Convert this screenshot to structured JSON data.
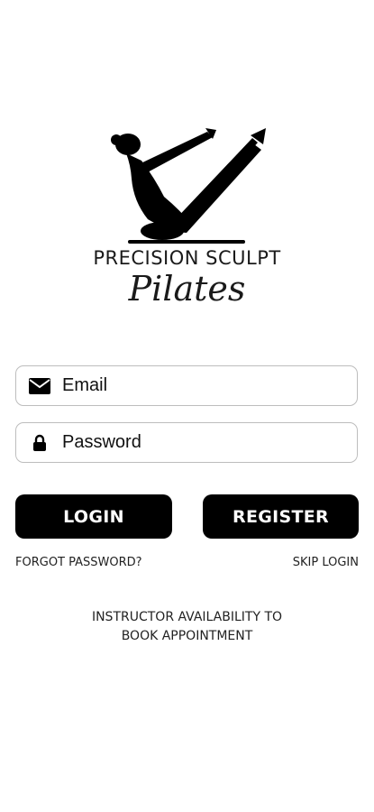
{
  "brand": {
    "name": "PRECISION SCULPT",
    "script": "Pilates"
  },
  "form": {
    "email_placeholder": "Email",
    "password_placeholder": "Password"
  },
  "buttons": {
    "login": "LOGIN",
    "register": "REGISTER"
  },
  "links": {
    "forgot_password": "FORGOT PASSWORD?",
    "skip_login": "SKIP LOGIN",
    "availability_line1": "INSTRUCTOR AVAILABILITY TO",
    "availability_line2": "BOOK APPOINTMENT"
  },
  "icons": {
    "email": "envelope-icon",
    "password": "lock-icon"
  },
  "colors": {
    "button_bg": "#000000",
    "button_text": "#ffffff",
    "field_border": "#bdbdbd"
  }
}
